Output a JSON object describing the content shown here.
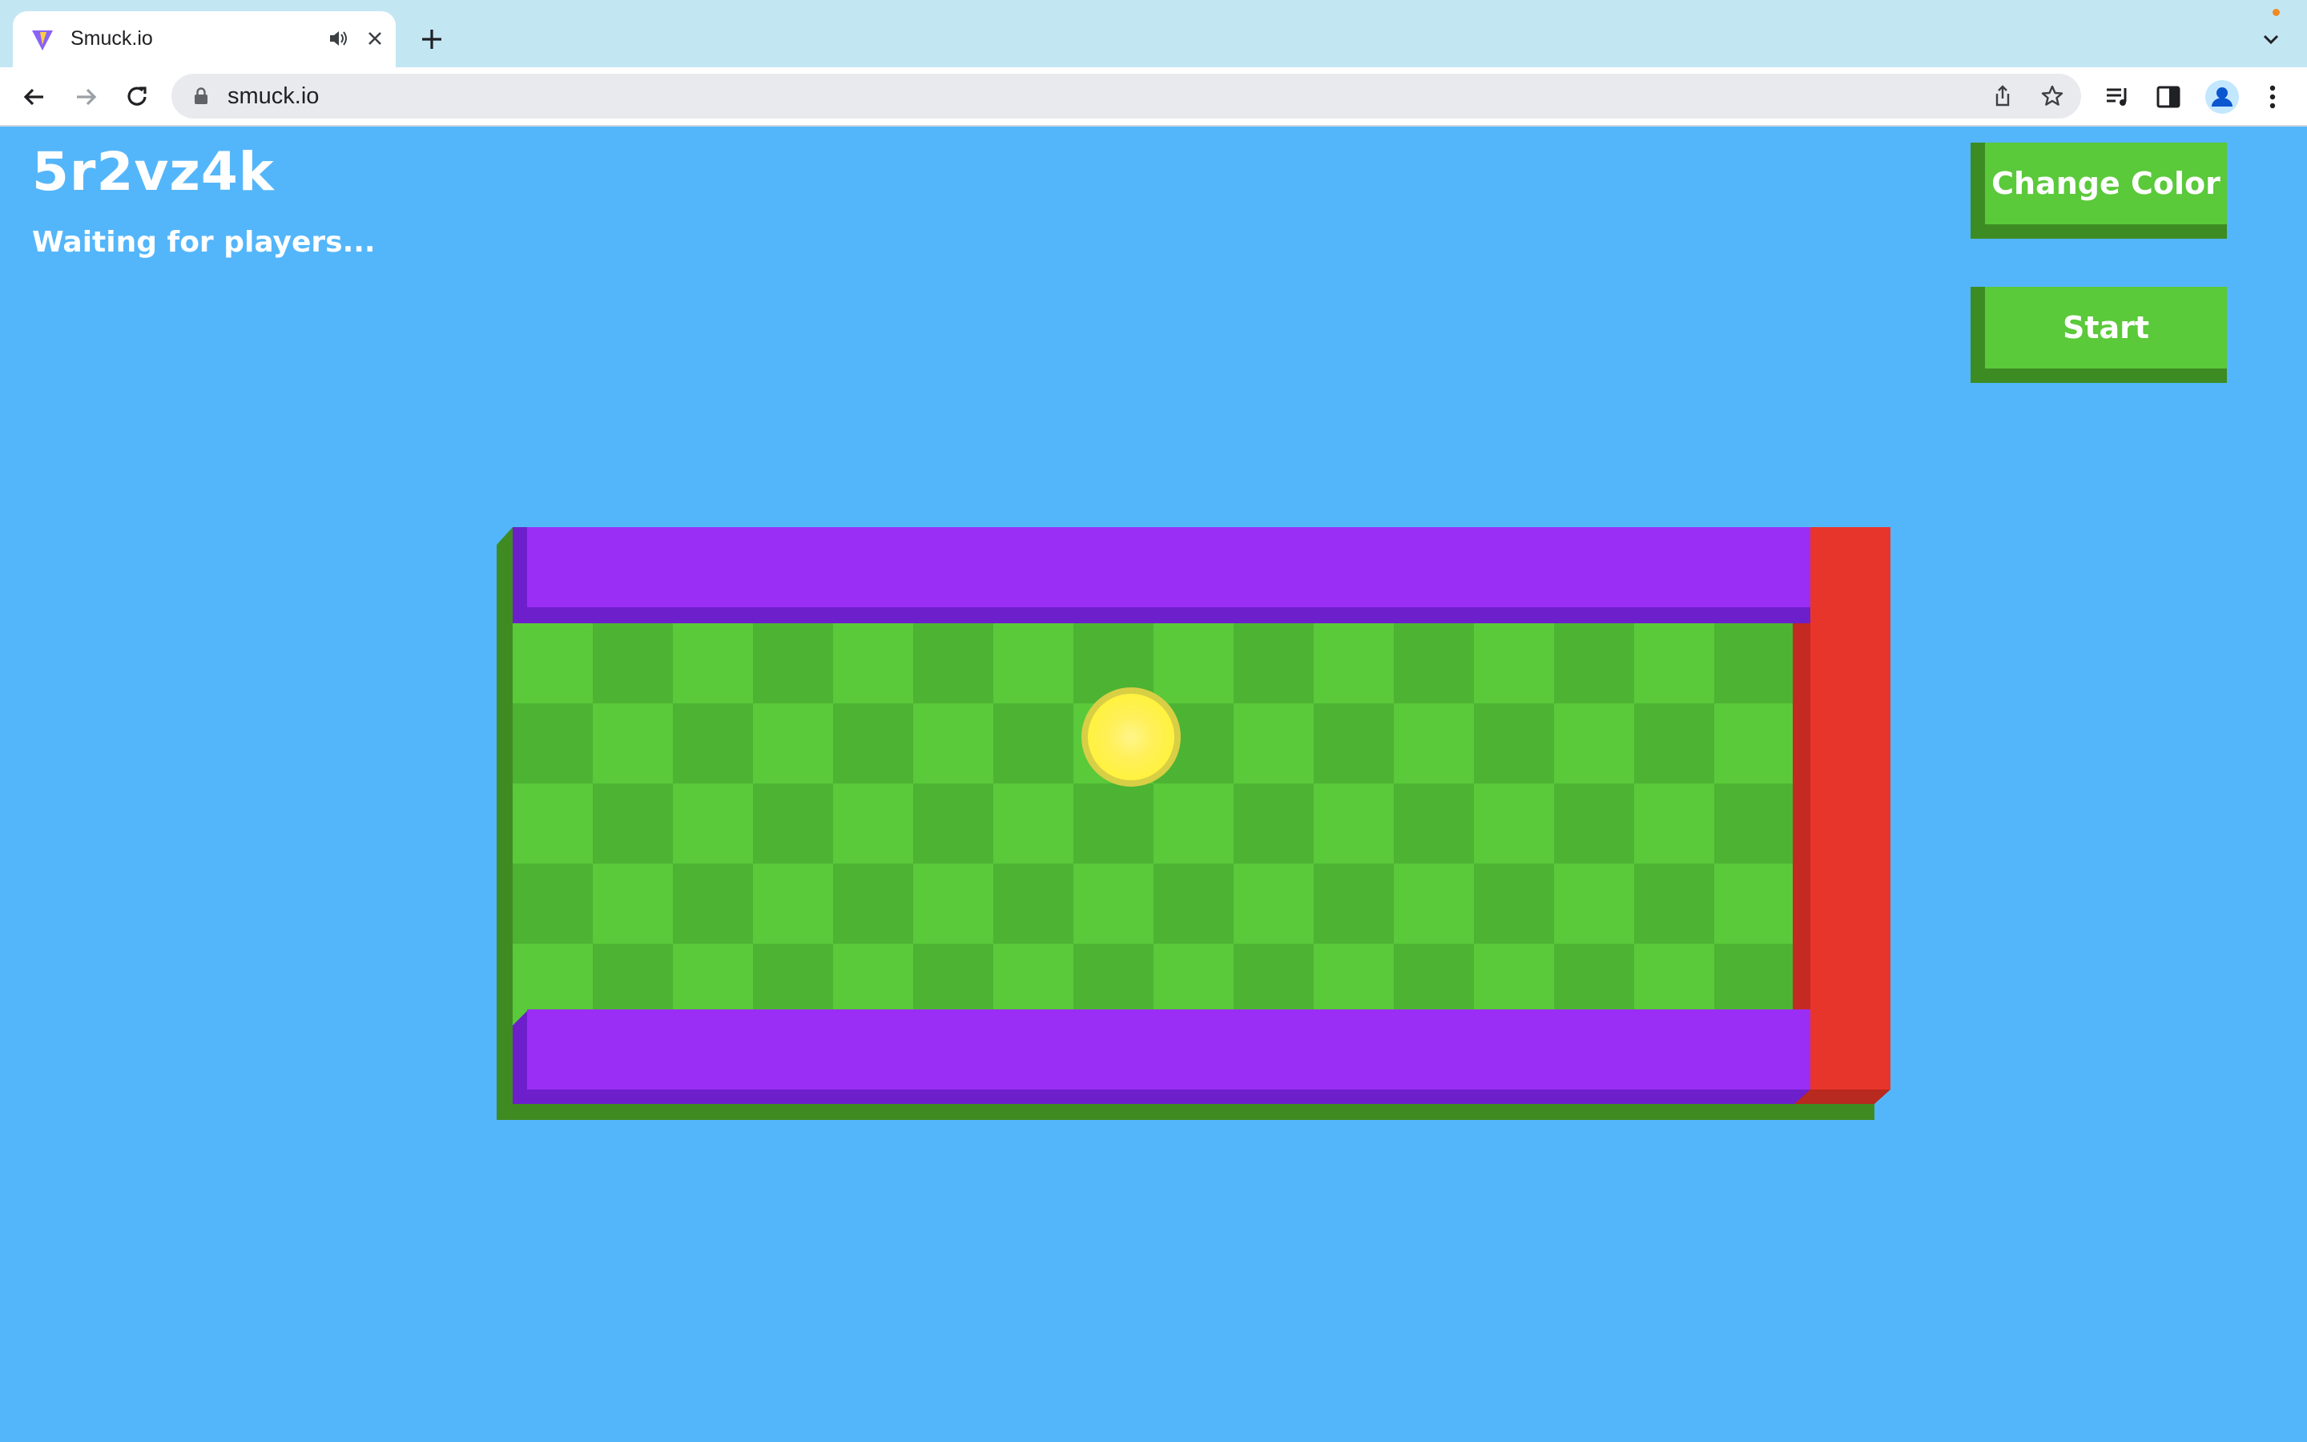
{
  "browser": {
    "tab_title": "Smuck.io",
    "url": "smuck.io",
    "icons": [
      "vite-favicon",
      "audio-icon",
      "close-icon",
      "plus-icon",
      "back-arrow-icon",
      "forward-arrow-icon",
      "reload-icon",
      "lock-icon",
      "share-icon",
      "star-icon",
      "media-icon",
      "sidepanel-icon",
      "profile-icon",
      "more-vert-icon",
      "chevron-down-icon"
    ]
  },
  "game": {
    "room_code": "5r2vz4k",
    "status": "Waiting for players...",
    "buttons": {
      "change_color": "Change Color",
      "start": "Start"
    },
    "colors": {
      "background": "#54b6fa",
      "wall_top_bottom": "#9a2ef5",
      "wall_right": "#e8352b",
      "field_light": "#5ac93a",
      "field_dark": "#4db333",
      "ball": "#fff23f",
      "button": "#5ac93a"
    }
  }
}
